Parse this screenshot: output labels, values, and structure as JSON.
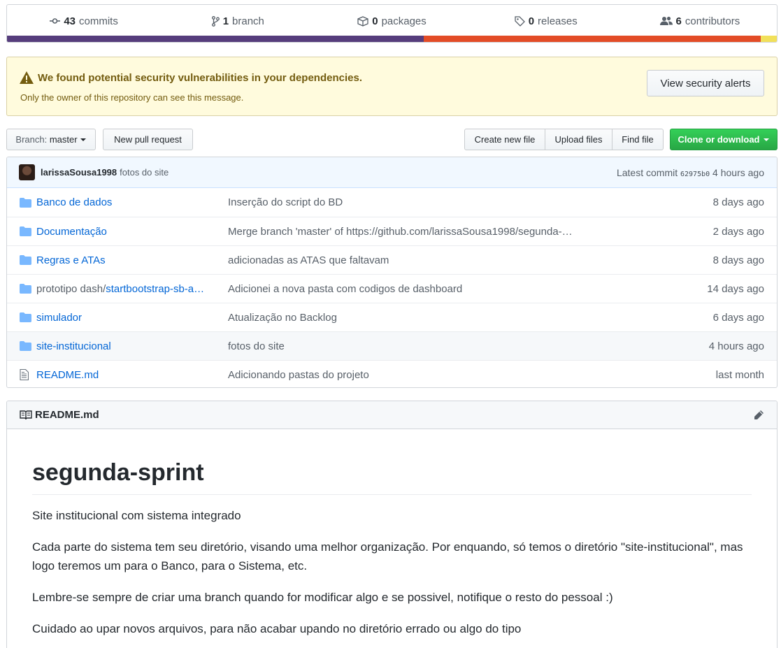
{
  "summary": {
    "commits": {
      "count": "43",
      "label": "commits"
    },
    "branch": {
      "count": "1",
      "label": "branch"
    },
    "packages": {
      "count": "0",
      "label": "packages"
    },
    "releases": {
      "count": "0",
      "label": "releases"
    },
    "contributors": {
      "count": "6",
      "label": "contributors"
    }
  },
  "language_bar": [
    {
      "color": "#563d7c",
      "share": 54.1
    },
    {
      "color": "#e34c26",
      "share": 43.8
    },
    {
      "color": "#f1e05a",
      "share": 2.1
    }
  ],
  "alert": {
    "title": "We found potential security vulnerabilities in your dependencies.",
    "subtitle": "Only the owner of this repository can see this message.",
    "button": "View security alerts"
  },
  "toolbar": {
    "branch_label": "Branch:",
    "branch_value": "master",
    "new_pr": "New pull request",
    "create_file": "Create new file",
    "upload_files": "Upload files",
    "find_file": "Find file",
    "clone": "Clone or download"
  },
  "commit": {
    "author": "larissaSousa1998",
    "message": "fotos do site",
    "latest_label": "Latest commit",
    "sha": "62975b0",
    "age": "4 hours ago"
  },
  "files": [
    {
      "type": "dir",
      "prefix": "",
      "name": "Banco de dados",
      "message": "Inserção do script do BD",
      "age": "8 days ago"
    },
    {
      "type": "dir",
      "prefix": "",
      "name": "Documentação",
      "message": "Merge branch 'master' of https://github.com/larissaSousa1998/segunda-…",
      "age": "2 days ago"
    },
    {
      "type": "dir",
      "prefix": "",
      "name": "Regras e ATAs",
      "message": "adicionadas as ATAS que faltavam",
      "age": "8 days ago"
    },
    {
      "type": "dir",
      "prefix": "prototipo dash/",
      "name": "startbootstrap-sb-a…",
      "message": "Adicionei a nova pasta com codigos de dashboard",
      "age": "14 days ago"
    },
    {
      "type": "dir",
      "prefix": "",
      "name": "simulador",
      "message": "Atualização no Backlog",
      "age": "6 days ago"
    },
    {
      "type": "dir",
      "prefix": "",
      "name": "site-institucional",
      "message": "fotos do site",
      "age": "4 hours ago"
    },
    {
      "type": "file",
      "prefix": "",
      "name": "README.md",
      "message": "Adicionando pastas do projeto",
      "age": "last month"
    }
  ],
  "readme": {
    "filename": "README.md",
    "heading": "segunda-sprint",
    "paragraphs": [
      "Site institucional com sistema integrado",
      "Cada parte do sistema tem seu diretório, visando uma melhor organização. Por enquando, só temos o diretório \"site-institucional\", mas logo teremos um para o Banco, para o Sistema, etc.",
      "Lembre-se sempre de criar uma branch quando for modificar algo e se possivel, notifique o resto do pessoal :)",
      "Cuidado ao upar novos arquivos, para não acabar upando no diretório errado ou algo do tipo"
    ]
  }
}
